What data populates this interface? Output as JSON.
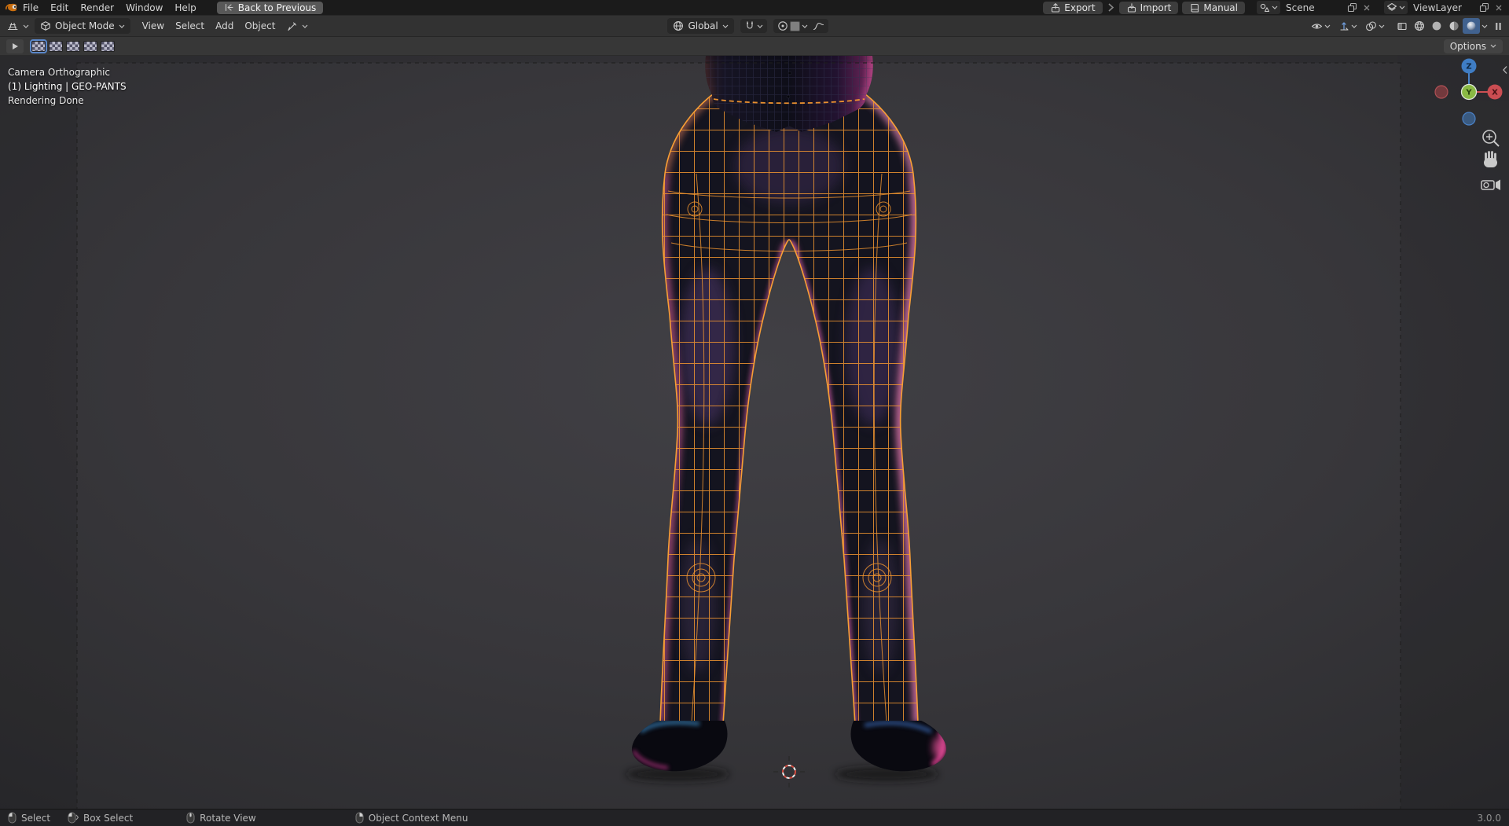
{
  "topbar": {
    "menus": [
      "File",
      "Edit",
      "Render",
      "Window",
      "Help"
    ],
    "back_button": "Back to Previous",
    "export_button": "Export",
    "import_button": "Import",
    "manual_button": "Manual",
    "scene_selector": "Scene",
    "viewlayer_selector": "ViewLayer"
  },
  "viewport_header": {
    "mode": "Object Mode",
    "menus": [
      "View",
      "Select",
      "Add",
      "Object"
    ],
    "orientation": "Global",
    "options": "Options"
  },
  "viewport": {
    "camera_label": "Camera Orthographic",
    "context_label": "(1) Lighting | GEO-PANTS",
    "render_status": "Rendering Done",
    "gizmo": {
      "x": "X",
      "y": "Y",
      "z": "Z"
    },
    "colors": {
      "selection_wire": "#f6982f",
      "axis_x": "#ca4d52",
      "axis_y": "#8ab944",
      "axis_z": "#3f7dc4"
    }
  },
  "statusbar": {
    "select": "Select",
    "box_select": "Box Select",
    "rotate_view": "Rotate View",
    "context_menu": "Object Context Menu",
    "version": "3.0.0"
  }
}
